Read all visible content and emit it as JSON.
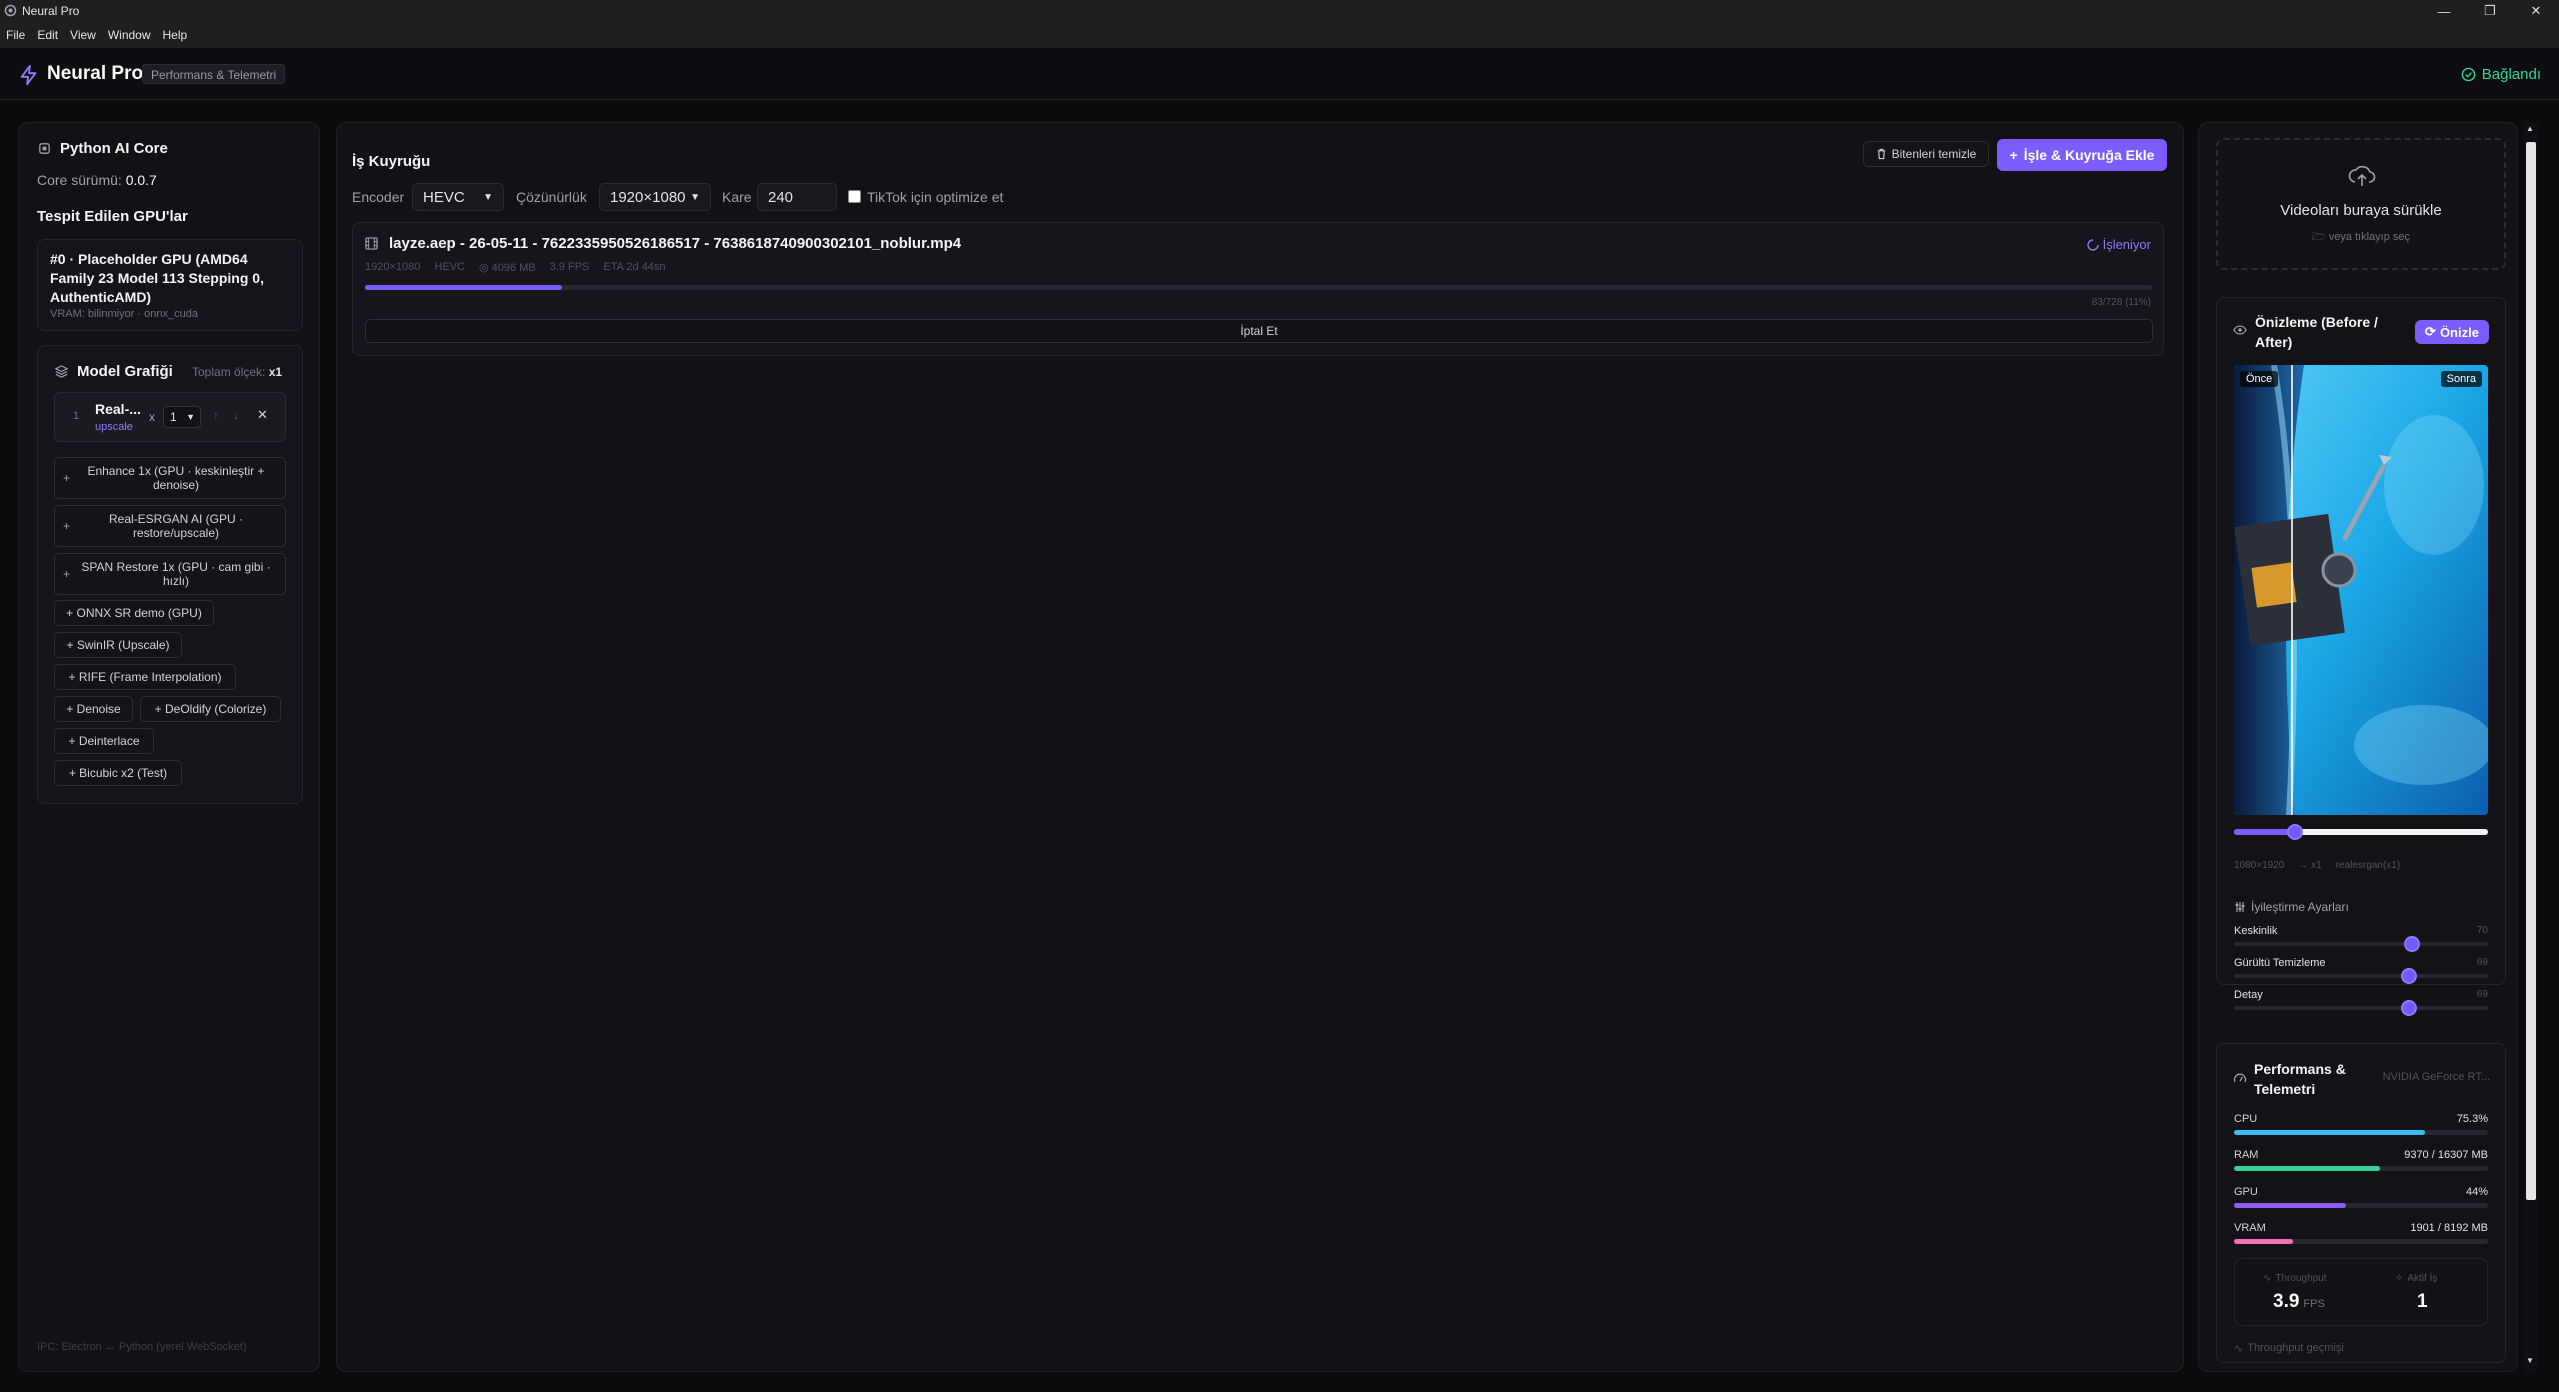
{
  "window": {
    "title": "Neural Pro"
  },
  "menu": [
    "File",
    "Edit",
    "View",
    "Window",
    "Help"
  ],
  "header": {
    "app_name": "Neural Pro",
    "badge": "Performans & Telemetri",
    "status": "Bağlandı"
  },
  "left": {
    "core_title": "Python AI Core",
    "core_version_label": "Core sürümü:",
    "core_version": "0.0.7",
    "gpu_section": "Tespit Edilen GPU'lar",
    "gpu_name": "#0 · Placeholder GPU (AMD64 Family 23 Model 113 Stepping 0, AuthenticAMD)",
    "gpu_meta": "VRAM: bilinmiyor · onnx_cuda",
    "model_graph_title": "Model Grafiği",
    "total_scale_label": "Toplam ölçek:",
    "total_scale_value": "x1",
    "node": {
      "index": "1",
      "name": "Real-...",
      "type": "upscale",
      "x": "x",
      "scale": "1"
    },
    "add_models": [
      "Enhance 1x (GPU · keskinleştir + denoise)",
      "Real-ESRGAN AI (GPU · restore/upscale)",
      "SPAN Restore 1x (GPU · cam gibi · hızlı)",
      "ONNX SR demo (GPU)",
      "SwinIR (Upscale)",
      "RIFE (Frame Interpolation)",
      "Denoise",
      "DeOldify (Colorize)",
      "Deinterlace",
      "Bicubic x2 (Test)"
    ],
    "footer": "IPC: Electron ↔ Python (yerel WebSocket)"
  },
  "queue": {
    "title": "İş Kuyruğu",
    "clear_label": "Bitenleri temizle",
    "add_label": "İşle & Kuyruğa Ekle",
    "encoder_label": "Encoder",
    "encoder_value": "HEVC",
    "resolution_label": "Çözünürlük",
    "resolution_value": "1920×1080",
    "frame_label": "Kare",
    "frame_value": "240",
    "tiktok_label": "TikTok için optimize et",
    "job": {
      "name": "layze.aep - 26-05-11 - 7622335950526186517 - 7638618740900302101_noblur.mp4",
      "status": "İşleniyor",
      "resolution": "1920×1080",
      "codec": "HEVC",
      "size": "4096 MB",
      "fps": "3.9 FPS",
      "eta": "ETA 2d 44sn",
      "progress_text": "83/728 (11%)",
      "progress": 0.11,
      "cancel_label": "İptal Et"
    }
  },
  "right": {
    "drop_title": "Videoları buraya sürükle",
    "drop_sub": "veya tıklayıp seç",
    "preview_title": "Önizleme (Before / After)",
    "preview_button": "Önizle",
    "before_label": "Önce",
    "after_label": "Sonra",
    "compare_position": 0.24,
    "meta_res": "1080×1920",
    "meta_scale": "→ x1",
    "meta_model": "realesrgan(x1)",
    "settings_title": "İyileştirme Ayarları",
    "sliders": [
      {
        "label": "Keskinlik",
        "value": 70
      },
      {
        "label": "Gürültü Temizleme",
        "value": 69
      },
      {
        "label": "Detay",
        "value": 69
      }
    ],
    "perf_title": "Performans & Telemetri",
    "gpu_short": "NVIDIA GeForce RT...",
    "metrics": [
      {
        "label": "CPU",
        "value": "75.3%",
        "fraction": 0.753,
        "color": "#38bdf8"
      },
      {
        "label": "RAM",
        "value": "9370 / 16307 MB",
        "fraction": 0.575,
        "color": "#34d399"
      },
      {
        "label": "GPU",
        "value": "44%",
        "fraction": 0.44,
        "color": "#8b5cf6"
      },
      {
        "label": "VRAM",
        "value": "1901 / 8192 MB",
        "fraction": 0.232,
        "color": "#f472b6"
      }
    ],
    "throughput_label": "Throughput",
    "throughput_value": "3.9",
    "throughput_unit": "FPS",
    "active_label": "Aktif İş",
    "active_value": "1",
    "history_label": "Throughput geçmişi"
  }
}
